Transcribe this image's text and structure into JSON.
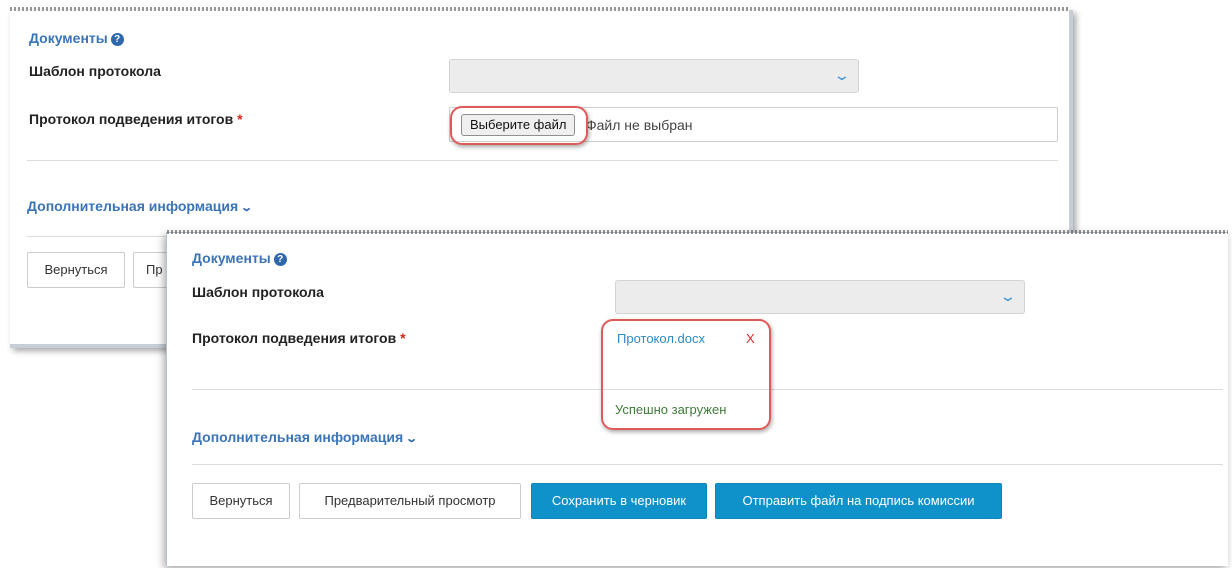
{
  "panel_before": {
    "documents_title": "Документы",
    "template_label": "Шаблон протокола",
    "template_value": "",
    "protocol_label": "Протокол подведения итогов",
    "required_mark": "*",
    "choose_file_label": "Выберите файл",
    "file_status": "Файл не выбран",
    "additional_info": "Дополнительная информация",
    "back_button": "Вернуться",
    "preview_button_partial": "Пр"
  },
  "panel_after": {
    "documents_title": "Документы",
    "template_label": "Шаблон протокола",
    "template_value": "",
    "protocol_label": "Протокол подведения итогов",
    "required_mark": "*",
    "uploaded_file": "Протокол.docx",
    "remove_label": "X",
    "upload_status": "Успешно загружен",
    "additional_info": "Дополнительная информация",
    "buttons": {
      "back": "Вернуться",
      "preview": "Предварительный просмотр",
      "save_draft": "Сохранить в черновик",
      "send_sign": "Отправить файл на подпись комиссии"
    }
  },
  "icons": {
    "help": "question-circle-icon",
    "chevron": "chevron-down-icon",
    "select_arrow": "select-chevron-icon"
  },
  "colors": {
    "accent": "#3a74b7",
    "primary_button": "#0e92c9",
    "highlight": "#e05a5a",
    "required": "#d9261c",
    "success": "#3f7a3a",
    "link": "#2a8bc5"
  }
}
